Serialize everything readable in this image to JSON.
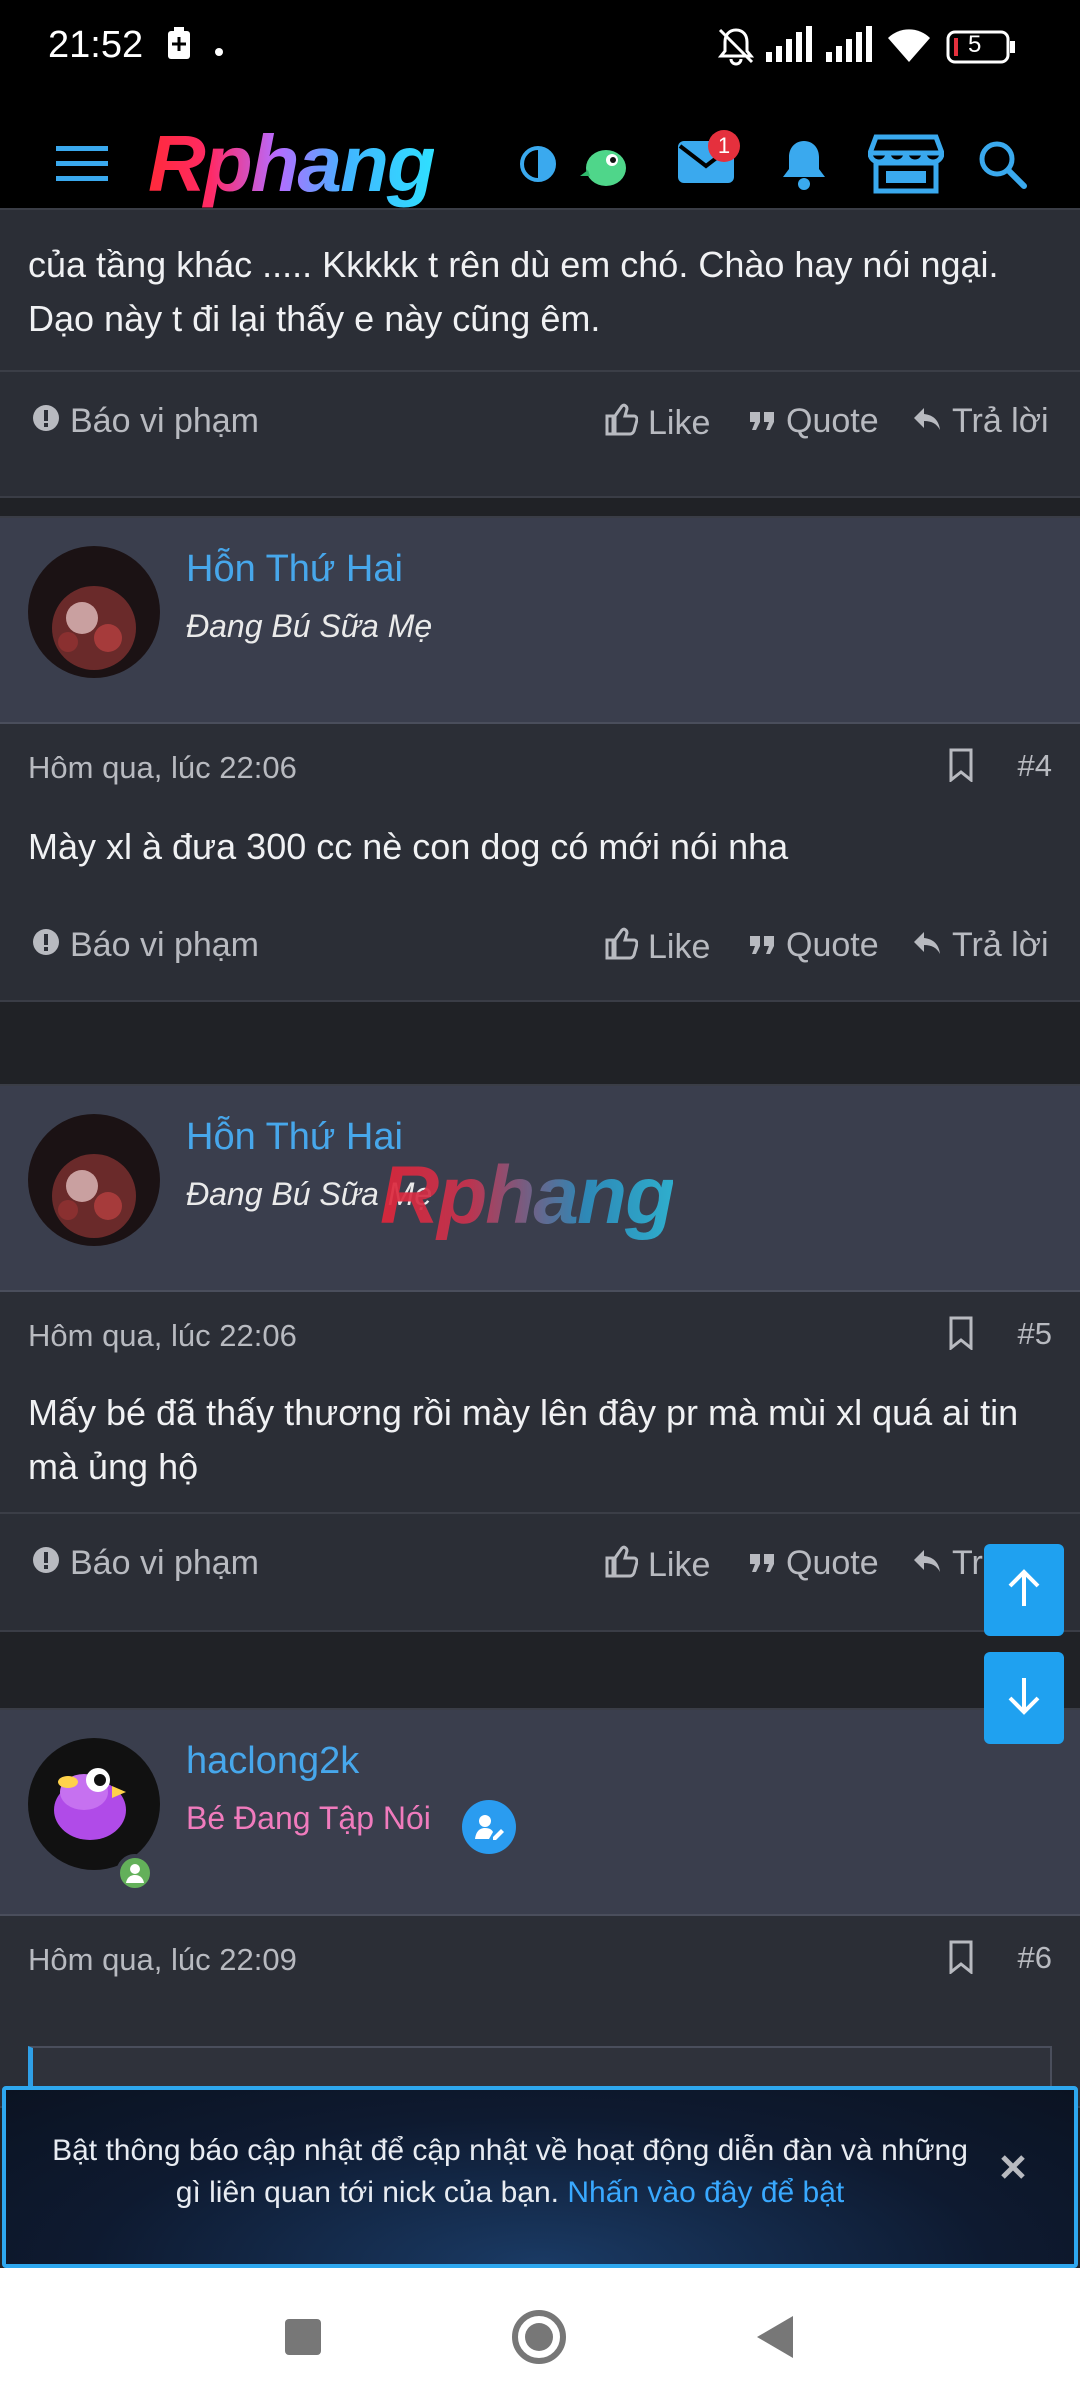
{
  "status_bar": {
    "time": "21:52",
    "battery_level": "5",
    "icons": [
      "battery-saver-icon",
      "dot-icon",
      "mute-bell-icon",
      "signal-icon",
      "signal-icon",
      "wifi-icon",
      "battery-icon"
    ]
  },
  "header": {
    "logo_text": "Rphang",
    "mail_badge": "1",
    "icons": [
      "menu-icon",
      "contrast-icon",
      "bird-avatar-icon",
      "mail-icon",
      "bell-icon",
      "store-icon",
      "search-icon"
    ]
  },
  "posts": [
    {
      "body": "của tầng khác ..... Kkkkk t rên dù em chó. Chào hay nói ngại. Dạo này t đi lại thấy e này cũng êm.",
      "actions": {
        "report": "Báo vi phạm",
        "like": "Like",
        "quote": "Quote",
        "reply": "Trả lời"
      }
    },
    {
      "username": "Hỗn Thứ Hai",
      "usertitle": "Đang Bú Sữa Mẹ",
      "date": "Hôm qua, lúc 22:06",
      "number": "#4",
      "body": "Mày xl à đưa 300 cc nè con dog có mới nói nha",
      "actions": {
        "report": "Báo vi phạm",
        "like": "Like",
        "quote": "Quote",
        "reply": "Trả lời"
      }
    },
    {
      "username": "Hỗn Thứ Hai",
      "usertitle": "Đang Bú Sữa Mẹ",
      "watermark": "Rphang",
      "date": "Hôm qua, lúc 22:06",
      "number": "#5",
      "body": "Mấy bé đã thấy thương rồi mày lên đây pr mà mùi xl quá ai tin mà ủng hộ",
      "actions": {
        "report": "Báo vi phạm",
        "like": "Like",
        "quote": "Quote",
        "reply": "Trả lời"
      }
    },
    {
      "username": "haclong2k",
      "usertitle": "Bé Đang Tập Nói",
      "date": "Hôm qua, lúc 22:09",
      "number": "#6"
    }
  ],
  "notification": {
    "text": "Bật thông báo cập nhật để cập nhật về hoạt động diễn đàn và những gì liên quan tới nick của bạn.",
    "link": "Nhấn vào đây để bật"
  },
  "colors": {
    "accent": "#47a7eb",
    "fab": "#1fa1f0",
    "pink_title": "#f07bbd",
    "badge": "#e5303d"
  }
}
